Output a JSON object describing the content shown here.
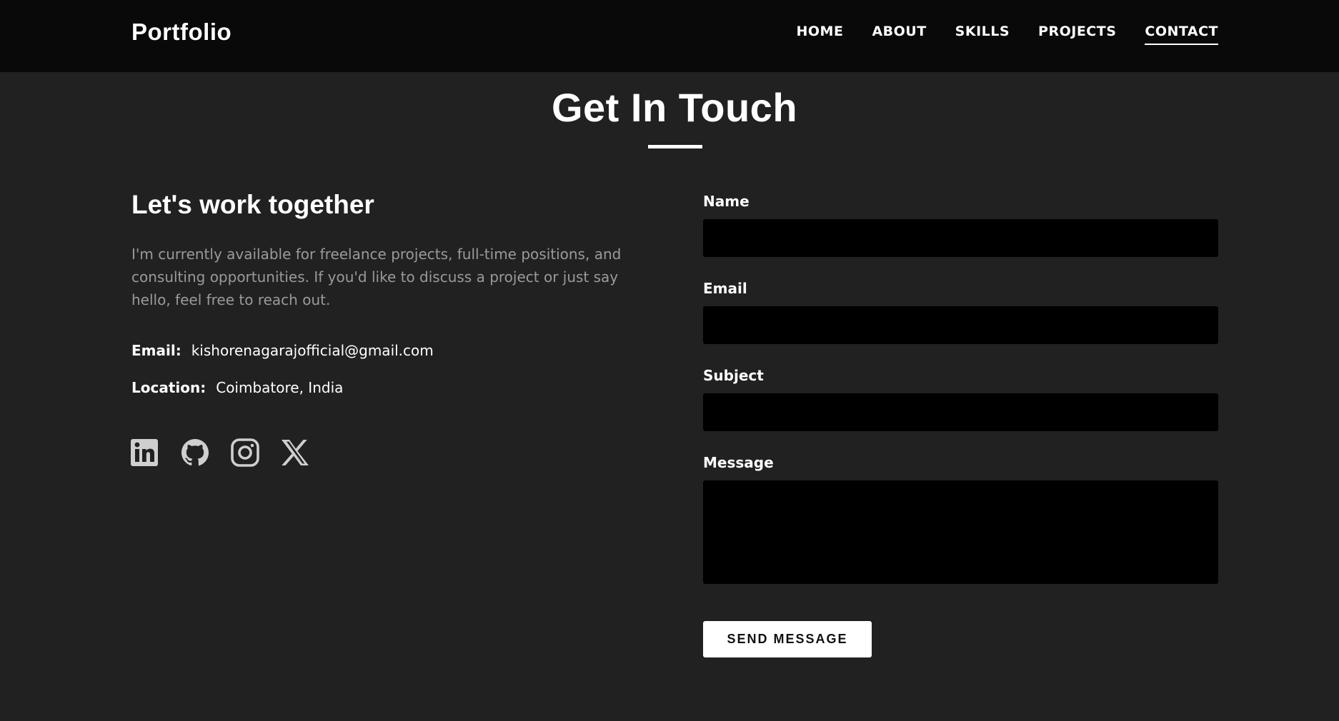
{
  "header": {
    "brand": "Portfolio",
    "nav": [
      {
        "label": "HOME"
      },
      {
        "label": "ABOUT"
      },
      {
        "label": "SKILLS"
      },
      {
        "label": "PROJECTS"
      },
      {
        "label": "CONTACT",
        "active": true
      }
    ]
  },
  "section": {
    "title": "Get In Touch"
  },
  "info": {
    "heading": "Let's work together",
    "text": "I'm currently available for freelance projects, full-time positions, and consulting opportunities. If you'd like to discuss a project or just say hello, feel free to reach out.",
    "email_label": "Email:",
    "email_value": "kishorenagarajofficial@gmail.com",
    "location_label": "Location:",
    "location_value": "Coimbatore, India",
    "socials": [
      "linkedin-icon",
      "github-icon",
      "instagram-icon",
      "x-icon"
    ]
  },
  "form": {
    "name_label": "Name",
    "name_value": "",
    "email_label": "Email",
    "email_value": "",
    "subject_label": "Subject",
    "subject_value": "",
    "message_label": "Message",
    "message_value": "",
    "submit_label": "SEND MESSAGE"
  },
  "colors": {
    "background": "#212121",
    "header_bg": "#090909",
    "input_bg": "#000000",
    "muted_text": "#9a9a9a",
    "icon": "#cfcfcf"
  }
}
